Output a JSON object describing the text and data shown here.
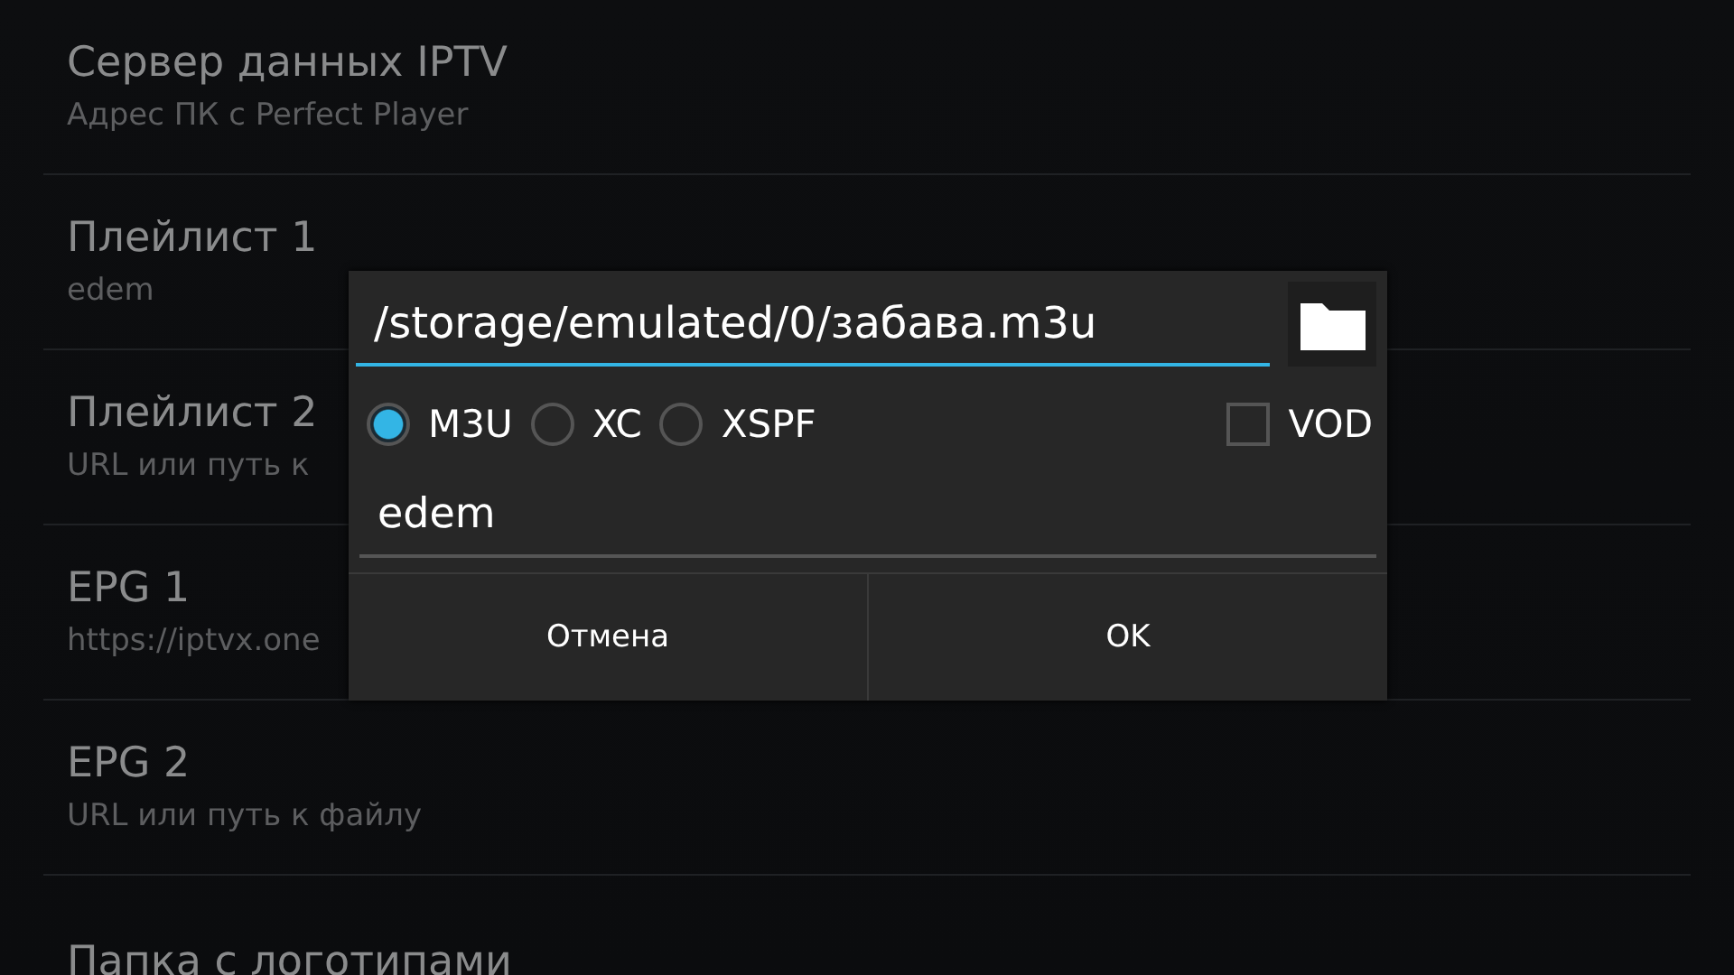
{
  "settings": [
    {
      "title": "Сервер данных IPTV",
      "subtitle": "Адрес ПК с Perfect Player"
    },
    {
      "title": "Плейлист 1",
      "subtitle": "edem"
    },
    {
      "title": "Плейлист 2",
      "subtitle": "URL или путь к"
    },
    {
      "title": "EPG 1",
      "subtitle": "https://iptvx.one"
    },
    {
      "title": "EPG 2",
      "subtitle": "URL или путь к файлу"
    },
    {
      "title": "Папка с логотипами"
    }
  ],
  "dialog": {
    "path": "/storage/emulated/0/забава.m3u",
    "formats": [
      {
        "label": "M3U",
        "selected": true
      },
      {
        "label": "XC",
        "selected": false
      },
      {
        "label": "XSPF",
        "selected": false
      }
    ],
    "vod": {
      "label": "VOD",
      "checked": false
    },
    "name": "edem",
    "buttons": [
      "Отмена",
      "OK"
    ]
  }
}
